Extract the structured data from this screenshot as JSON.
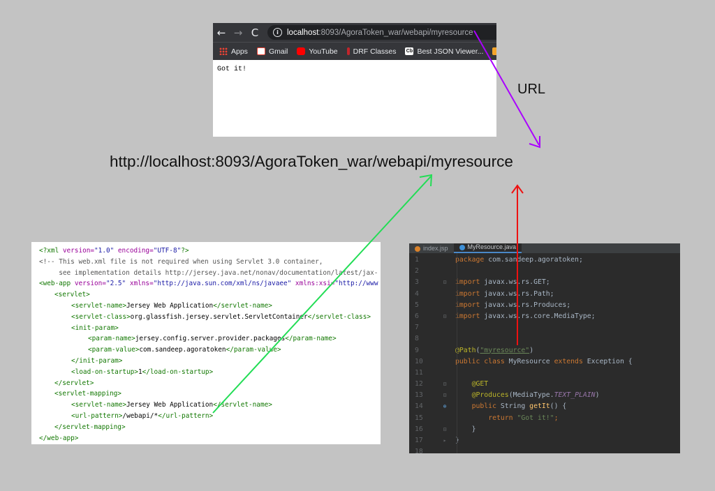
{
  "browser": {
    "nav_back": "←",
    "nav_forward": "→",
    "nav_reload": "C",
    "url_host": "localhost",
    "url_path": ":8093/AgoraToken_war/webapi/myresource",
    "bookmarks": [
      {
        "label": "Apps",
        "icon": "apps-grid-icon"
      },
      {
        "label": "Gmail",
        "icon": "gmail-icon"
      },
      {
        "label": "YouTube",
        "icon": "youtube-icon"
      },
      {
        "label": "DRF Classes",
        "icon": "drf-icon"
      },
      {
        "label": "Best JSON Viewer...",
        "icon": "cb-icon"
      }
    ],
    "page_text": "Got it!"
  },
  "url_label": "URL",
  "full_url": "http://localhost:8093/AgoraToken_war/webapi/myresource",
  "xml": {
    "l1_open": "<?xml ",
    "l1_a1": "version=",
    "l1_v1": "\"1.0\"",
    "l1_a2": " encoding=",
    "l1_v2": "\"UTF-8\"",
    "l1_close": "?>",
    "l2": "<!-- This web.xml file is not required when using Servlet 3.0 container,",
    "l3": "     see implementation details http://jersey.java.net/nonav/documentation/latest/jax-",
    "l4_tag": "<web-app ",
    "l4_a1": "version=",
    "l4_v1": "\"2.5\"",
    "l4_a2": " xmlns=",
    "l4_v2": "\"http://java.sun.com/xml/ns/javaee\"",
    "l4_a3": " xmlns:xsi=",
    "l4_v3": "\"http://www",
    "l5": "<servlet>",
    "l6_t1": "<servlet-name>",
    "l6_txt": "Jersey Web Application",
    "l6_t2": "</servlet-name>",
    "l7_t1": "<servlet-class>",
    "l7_txt": "org.glassfish.jersey.servlet.ServletContainer",
    "l7_t2": "</servlet-class>",
    "l8": "<init-param>",
    "l9_t1": "<param-name>",
    "l9_txt": "jersey.config.server.provider.packages",
    "l9_t2": "</param-name>",
    "l10_t1": "<param-value>",
    "l10_txt": "com.sandeep.agoratoken",
    "l10_t2": "</param-value>",
    "l11": "</init-param>",
    "l12_t1": "<load-on-startup>",
    "l12_txt": "1",
    "l12_t2": "</load-on-startup>",
    "l13": "</servlet>",
    "l14": "<servlet-mapping>",
    "l15_t1": "<servlet-name>",
    "l15_txt": "Jersey Web Application",
    "l15_t2": "</servlet-name>",
    "l16_t1": "<url-pattern>",
    "l16_txt": "/webapi/*",
    "l16_t2": "</url-pattern>",
    "l17": "</servlet-mapping>",
    "l18": "</web-app>"
  },
  "ide": {
    "tab1": "index.jsp",
    "tab2": "MyResource.java",
    "line_numbers": [
      "1",
      "2",
      "3",
      "4",
      "5",
      "6",
      "7",
      "8",
      "9",
      "10",
      "11",
      "12",
      "13",
      "14",
      "15",
      "16",
      "17",
      "18"
    ],
    "c1_kw": "package",
    "c1_txt": " com.sandeep.agoratoken;",
    "c3_kw": "import",
    "c3_txt": " javax.ws.rs.GET;",
    "c4_kw": "import",
    "c4_txt": " javax.ws.rs.Path;",
    "c5_kw": "import",
    "c5_txt": " javax.ws.rs.Produces;",
    "c6_kw": "import",
    "c6_txt": " javax.ws.rs.core.MediaType;",
    "c9_an": "@Path",
    "c9_p1": "(",
    "c9_str": "\"myresource\"",
    "c9_p2": ")",
    "c10_kw1": "public class",
    "c10_txt1": " MyResource ",
    "c10_kw2": "extends",
    "c10_txt2": " Exception {",
    "c12_an": "@GET",
    "c13_an": "@Produces",
    "c13_p1": "(MediaType.",
    "c13_it": "TEXT_PLAIN",
    "c13_p2": ")",
    "c14_kw": "public",
    "c14_txt1": " String ",
    "c14_fn": "getIt",
    "c14_txt2": "() {",
    "c15_kw": "return",
    "c15_txt": " ",
    "c15_str": "\"Got it!\"",
    "c15_end": ";",
    "c16": "}",
    "c17": "}"
  },
  "colors": {
    "purple_arrow": "#aa00ff",
    "green_arrow": "#22dd55",
    "red_arrow": "#ee1111"
  }
}
